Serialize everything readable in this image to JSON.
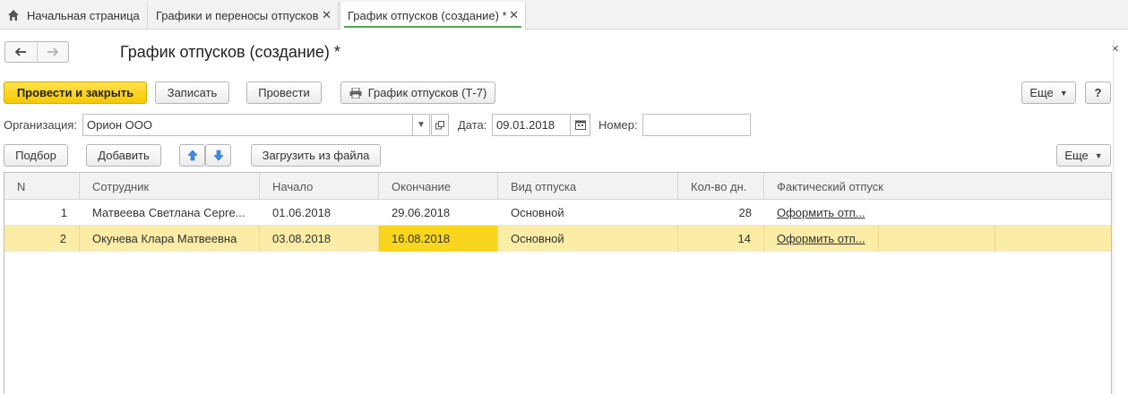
{
  "tabs": {
    "home_label": "Начальная страница",
    "tab2_label": "Графики и переносы отпусков",
    "tab3_label": "График отпусков (создание) *",
    "close_glyph": "✕"
  },
  "form": {
    "title": "График отпусков (создание) *",
    "back_glyph": "🡐",
    "forward_glyph": "🡒",
    "close_glyph": "×"
  },
  "toolbar": {
    "post_close_label": "Провести и закрыть",
    "write_label": "Записать",
    "post_label": "Провести",
    "print_label": "График отпусков (Т-7)",
    "more_label": "Еще",
    "help_label": "?"
  },
  "header_fields": {
    "org_label": "Организация:",
    "org_value": "Орион ООО",
    "date_label": "Дата:",
    "date_value": "09.01.2018",
    "number_label": "Номер:",
    "number_value": ""
  },
  "table_toolbar": {
    "pick_label": "Подбор",
    "add_label": "Добавить",
    "load_label": "Загрузить из файла",
    "more_label": "Еще"
  },
  "table": {
    "columns": [
      "N",
      "Сотрудник",
      "Начало",
      "Окончание",
      "Вид отпуска",
      "Кол-во дн.",
      "Фактический отпуск"
    ],
    "rows": [
      {
        "n": "1",
        "employee": "Матвеева Светлана Серге...",
        "start": "01.06.2018",
        "end": "29.06.2018",
        "type": "Основной",
        "days": "28",
        "actual": "Оформить отп..."
      },
      {
        "n": "2",
        "employee": "Окунева Клара Матвеевна",
        "start": "03.08.2018",
        "end": "16.08.2018",
        "type": "Основной",
        "days": "14",
        "actual": "Оформить отп..."
      }
    ]
  },
  "colors": {
    "primary_button": "#f5c900",
    "selected_row": "#fbeca6",
    "active_cell": "#f8d51e",
    "tab_underline": "#53a653"
  },
  "icons": [
    "home-icon",
    "close-icon",
    "arrow-left-icon",
    "arrow-right-icon",
    "printer-icon",
    "dropdown-icon",
    "open-icon",
    "calendar-icon",
    "arrow-up-icon",
    "arrow-down-icon"
  ]
}
